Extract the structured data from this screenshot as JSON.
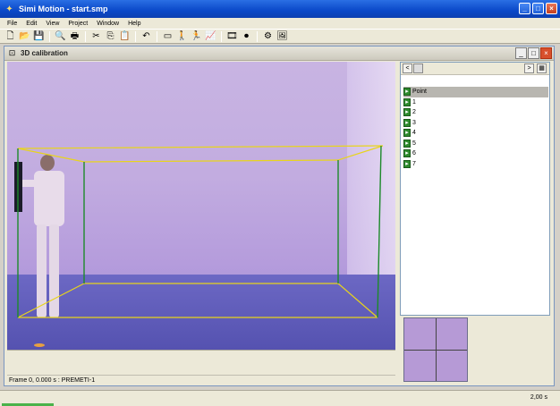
{
  "app": {
    "title": "Simi Motion - start.smp",
    "icon": "simi-logo-icon",
    "buttons": {
      "minimize": "_",
      "maximize": "□",
      "close": "×"
    }
  },
  "menu": [
    "File",
    "Edit",
    "View",
    "Project",
    "Window",
    "Help"
  ],
  "toolbar": {
    "icons": [
      {
        "name": "new-file-icon",
        "glyph": "🗋"
      },
      {
        "name": "open-folder-icon",
        "glyph": "📂"
      },
      {
        "name": "save-icon",
        "glyph": "💾"
      },
      {
        "name": "print-preview-icon",
        "glyph": "🔍"
      },
      {
        "name": "print-icon",
        "glyph": "🖶"
      },
      {
        "name": "cut-icon",
        "glyph": "✂"
      },
      {
        "name": "copy-icon",
        "glyph": "⎘"
      },
      {
        "name": "paste-icon",
        "glyph": "📋"
      },
      {
        "name": "undo-icon",
        "glyph": "↶"
      },
      {
        "name": "camera-view-icon",
        "glyph": "▭"
      },
      {
        "name": "person-figure-icon",
        "glyph": "🚶"
      },
      {
        "name": "stick-figure-icon",
        "glyph": "🏃"
      },
      {
        "name": "graph-icon",
        "glyph": "📈"
      },
      {
        "name": "video-icon",
        "glyph": "🎞"
      },
      {
        "name": "record-icon",
        "glyph": "⏺"
      },
      {
        "name": "settings-icon",
        "glyph": "⚙"
      },
      {
        "name": "image-icon",
        "glyph": "🖼"
      }
    ]
  },
  "child_window": {
    "title": "3D calibration",
    "icon": "calibration-icon",
    "buttons": {
      "minimize": "_",
      "maximize": "□",
      "close": "×"
    }
  },
  "side_panel": {
    "nav_left": "<",
    "nav_right": ">",
    "header": "Point",
    "points": [
      "1",
      "2",
      "3",
      "4",
      "5",
      "6",
      "7"
    ]
  },
  "frame_info": "Frame 0, 0.000 s : PREMETI-1",
  "status_time": "2,00 s",
  "colors": {
    "calibration_frame": "#e8d41c",
    "calibration_vertical": "#1d8a2a"
  }
}
